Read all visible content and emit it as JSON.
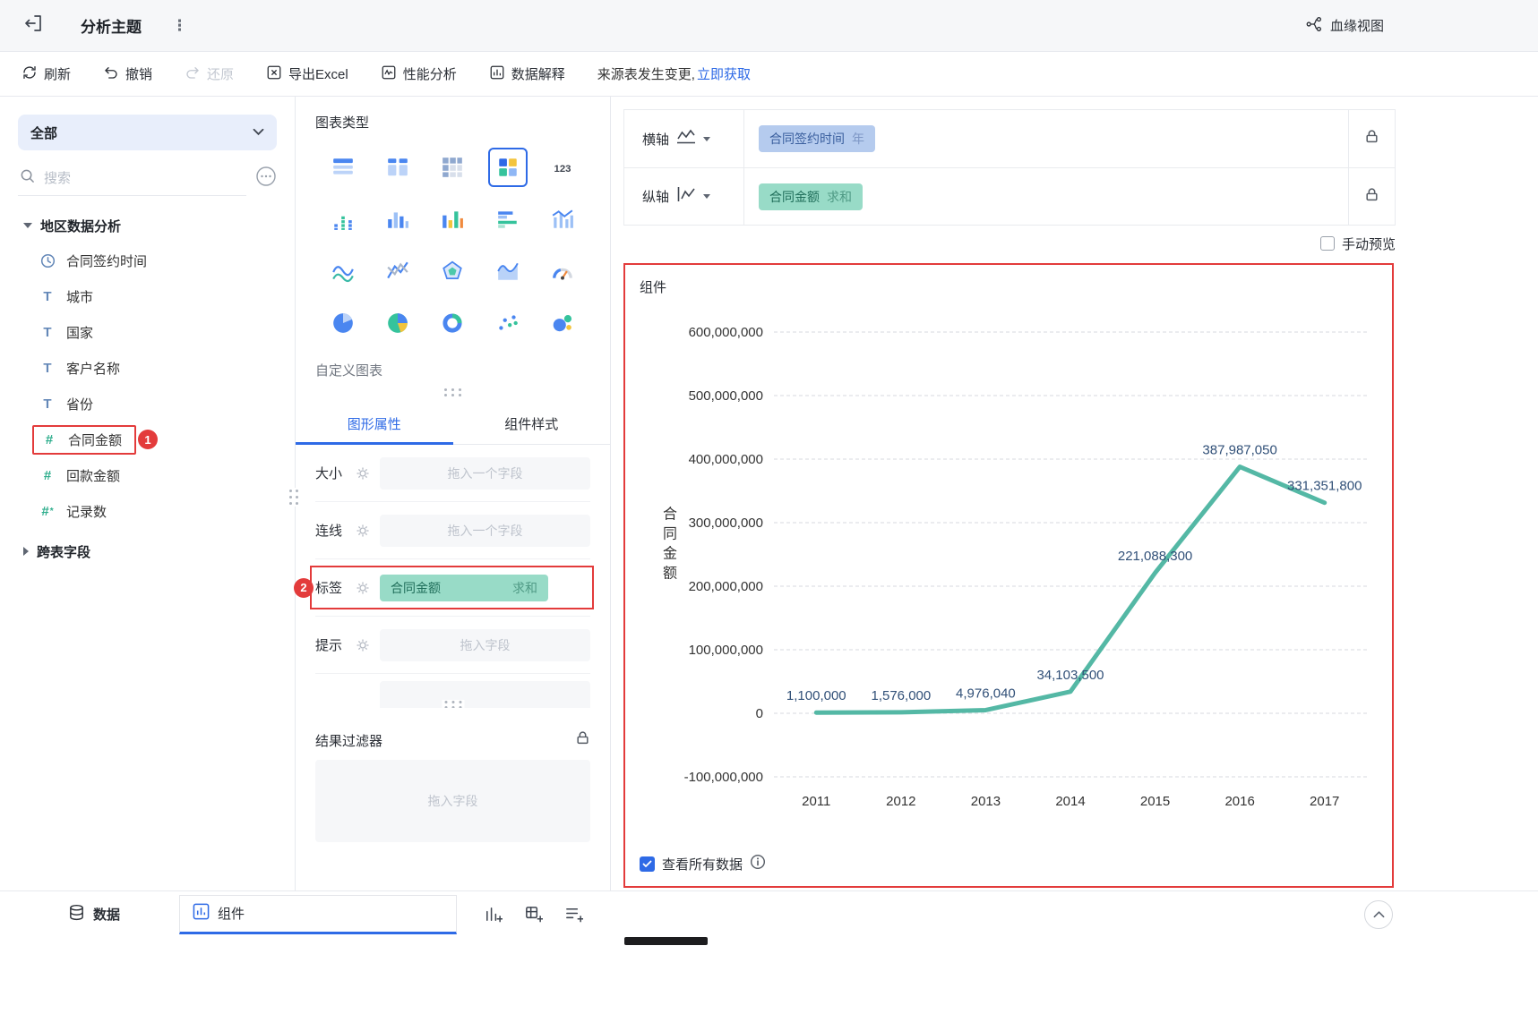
{
  "header": {
    "title": "分析主题",
    "lineage": "血缘视图"
  },
  "toolbar": {
    "refresh": "刷新",
    "undo": "撤销",
    "redo": "还原",
    "export_excel": "导出Excel",
    "performance": "性能分析",
    "data_explain": "数据解释",
    "source_changed": "来源表发生变更,",
    "get_now": "立即获取"
  },
  "sidebar": {
    "all": "全部",
    "search_placeholder": "搜索",
    "group": "地区数据分析",
    "fields": [
      {
        "name": "合同签约时间"
      },
      {
        "name": "城市"
      },
      {
        "name": "国家"
      },
      {
        "name": "客户名称"
      },
      {
        "name": "省份"
      },
      {
        "name": "合同金额"
      },
      {
        "name": "回款金额"
      },
      {
        "name": "记录数"
      }
    ],
    "cross_table": "跨表字段",
    "badge_1": "1"
  },
  "panel": {
    "chart_type_title": "图表类型",
    "icon_123": "123",
    "custom_chart": "自定义图表",
    "tab_graphic": "图形属性",
    "tab_style": "组件样式",
    "rows": {
      "size_label": "大小",
      "size_placeholder": "拖入一个字段",
      "line_label": "连线",
      "line_placeholder": "拖入一个字段",
      "label_label": "标签",
      "label_field": "合同金额",
      "label_agg": "求和",
      "tip_label": "提示",
      "tip_placeholder": "拖入字段"
    },
    "badge_2": "2",
    "filter_title": "结果过滤器",
    "filter_placeholder": "拖入字段"
  },
  "canvas": {
    "x_axis": "横轴",
    "x_field": "合同签约时间",
    "x_suffix": "年",
    "y_axis": "纵轴",
    "y_field": "合同金额",
    "y_suffix": "求和",
    "manual_preview": "手动预览",
    "view_all": "查看所有数据"
  },
  "bottombar": {
    "data_tab": "数据",
    "component_tab": "组件"
  },
  "chart_data": {
    "type": "line",
    "title": "组件",
    "categories": [
      "2011",
      "2012",
      "2013",
      "2014",
      "2015",
      "2016",
      "2017"
    ],
    "values": [
      1100000,
      1576000,
      4976040,
      34103500,
      221088300,
      387987050,
      331351800
    ],
    "point_labels": [
      "1,100,000",
      "1,576,000",
      "4,976,040",
      "34,103,500",
      "221,088,300",
      "387,987,050",
      "331,351,800"
    ],
    "xlabel": "",
    "ylabel": "合同金额",
    "ylim": [
      -100000000,
      600000000
    ],
    "ytick_step": 100000000,
    "ytick_labels": [
      "600,000,000",
      "500,000,000",
      "400,000,000",
      "300,000,000",
      "200,000,000",
      "100,000,000",
      "0",
      "-100,000,000"
    ],
    "grid": "dashed",
    "legend": "none",
    "line_color": "#54b8a5",
    "point_label_color": "#315078"
  }
}
